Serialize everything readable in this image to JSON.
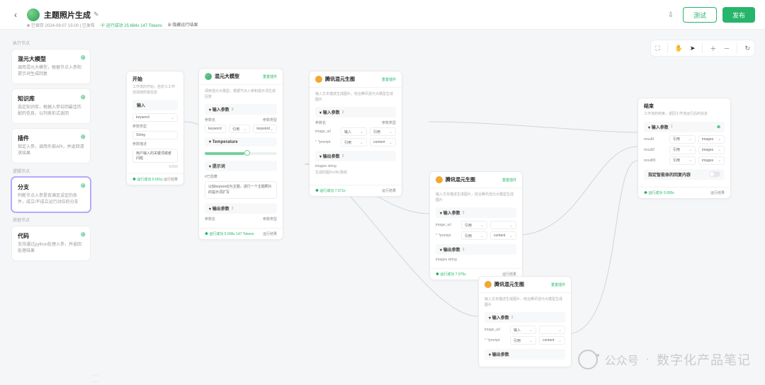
{
  "header": {
    "title": "主题照片生成",
    "saved": "已保存 2024-09-07 15:00 | 已发布",
    "run_info": "运行成功 25.684s 147 Tokens",
    "hide_results": "隐藏运行结果",
    "test_btn": "测试",
    "publish_btn": "发布"
  },
  "palette": {
    "sec_exec": "执行节点",
    "sec_logic": "逻辑节点",
    "sec_data": "其他节点",
    "items": [
      {
        "title": "混元大模型",
        "desc": "调用混元大模型，根据节点入参和提示词生成回复"
      },
      {
        "title": "知识库",
        "desc": "选定知识库，根据入参召回最佳匹配的信息，以列表形式返回"
      },
      {
        "title": "插件",
        "desc": "指定入参，调用外部API，并返回请求结果"
      },
      {
        "title": "分支",
        "desc": "判断节点入参是否满足设定的条件，成立/不成立运行对应的分支"
      },
      {
        "title": "代码",
        "desc": "支持通过python处理入参，并返回处理结果"
      }
    ]
  },
  "nodes": {
    "start": {
      "title": "开始",
      "desc": "工作流的开始，自定义工作流调用所需信息",
      "input_label": "输入",
      "rows": [
        {
          "name": "keyword",
          "type": ""
        },
        {
          "label": "参数类型",
          "type": "String"
        },
        {
          "label": "参数描述",
          "type": "用户输入的关键词或者问题"
        }
      ],
      "status": "运行成功 0.001s",
      "run": "运行结果"
    },
    "llm": {
      "title": "混元大模型",
      "desc": "调用混元大模型，根据节点入参和提示词生成回复",
      "reset": "重置插件",
      "in_label": "输入参数",
      "in_count": "3",
      "p_label": "参数名",
      "p_type": "参数类型",
      "row_name": "keyword",
      "row_ref": "引用",
      "row_val": "keyword",
      "temp_label": "Temperature",
      "prompt_label": "提示词",
      "prompt_sub": "#已隐藏",
      "prompt_text": "以${keyword}为主题，进行一个主题照片的提示词扩写",
      "out_label": "输出参数",
      "out_count": "2",
      "out_row_name": "参数名",
      "out_row_type": "参数类型",
      "status": "运行成功 5.506s 147 Tokens",
      "run": "运行结果"
    },
    "img1": {
      "title": "腾讯混元生图",
      "desc": "输入文本描述生成图片，结合腾讯混元大模型生成图片",
      "reset": "重置插件",
      "in_label": "输入参数",
      "in_count": "2",
      "p_name": "参数名",
      "p_type": "参数类型",
      "r1": "image_url",
      "r1t": "输入",
      "r1v": "引用",
      "r2": "*prompt",
      "r2t": "引用",
      "r2v": "content",
      "out_label": "输出参数",
      "out_count": "2",
      "o1": "images string",
      "o1d": "生成的图片URL数组",
      "status": "运行成功 7.571s",
      "run": "运行结果"
    },
    "img2": {
      "title": "腾讯混元生图",
      "desc": "输入文本描述生成图片，结合腾讯混元大模型生成图片",
      "reset": "重置插件",
      "in_label": "输入参数",
      "in_count": "2",
      "r1": "image_url",
      "r1t": "引用",
      "r1v": "",
      "r2": "*prompt",
      "r2t": "引用",
      "r2v": "content",
      "out_label": "输出参数",
      "out_count": "2",
      "o1": "images string",
      "status": "运行成功 7.975s",
      "run": "运行结果"
    },
    "img3": {
      "title": "腾讯混元生图",
      "desc": "输入文本描述生成图片，结合腾讯混元大模型生成图片",
      "reset": "重置插件",
      "in_label": "输入参数",
      "in_count": "2",
      "r1": "image_url",
      "r1t": "输入",
      "r1v": "",
      "r2": "*prompt",
      "r2t": "引用",
      "r2v": "content",
      "out_label": "输出参数",
      "status": ""
    },
    "end": {
      "title": "结束",
      "desc": "工作流的结束，返回工作流运行后的信息",
      "in_label": "输入参数",
      "in_count": "1",
      "rows": [
        {
          "name": "result1",
          "ref": "引用",
          "val": "images"
        },
        {
          "name": "result2",
          "ref": "引用",
          "val": "images"
        },
        {
          "name": "resultf3",
          "ref": "引用",
          "val": "images"
        }
      ],
      "reply_label": "指定智能体的回复内容",
      "status": "运行成功 0.000s",
      "run": "运行结果"
    }
  },
  "watermark": {
    "prefix": "公众号",
    "text": "数字化产品笔记"
  }
}
